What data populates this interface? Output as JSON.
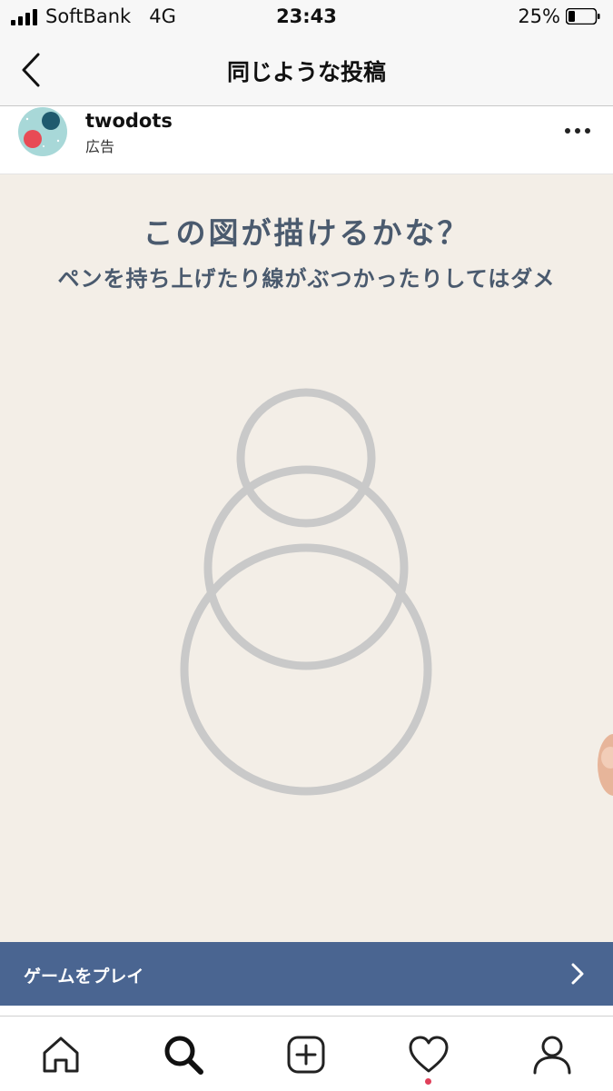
{
  "status_bar": {
    "carrier": "SoftBank",
    "network": "4G",
    "time": "23:43",
    "battery_percent": "25%",
    "battery_level": 0.25
  },
  "header": {
    "title": "同じような投稿"
  },
  "post": {
    "username": "twodots",
    "sponsored_label": "広告"
  },
  "ad": {
    "headline": "この図が描けるかな？",
    "subline": "ペンを持ち上げたり線がぶつかったりしてはダメ",
    "figure_color": "#c9c9c9",
    "background_color": "#f3eee7"
  },
  "cta": {
    "label": "ゲームをプレイ",
    "color": "#4a6591"
  },
  "tab_bar": {
    "items": [
      {
        "icon": "home-icon"
      },
      {
        "icon": "search-icon",
        "active": true
      },
      {
        "icon": "add-post-icon"
      },
      {
        "icon": "heart-icon",
        "has_notification": true
      },
      {
        "icon": "profile-icon"
      }
    ]
  }
}
